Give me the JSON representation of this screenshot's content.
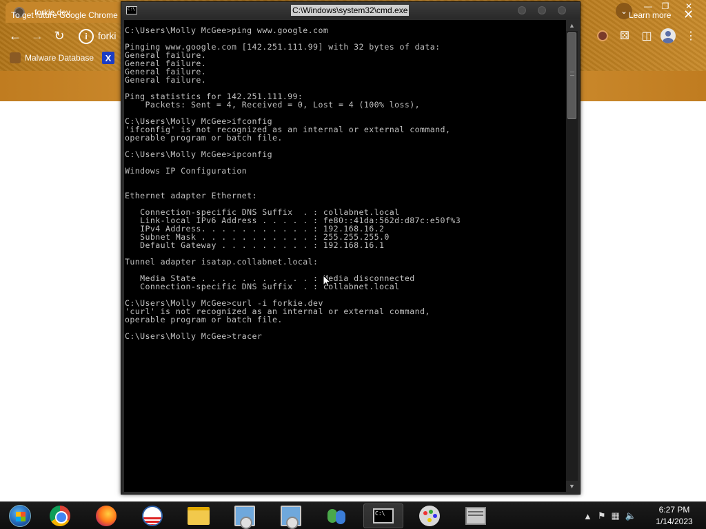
{
  "browser": {
    "tab_title": "forkie.dev",
    "address_text": "forki",
    "bookmarks": [
      {
        "label": "Malware Database"
      },
      {
        "label": ""
      }
    ],
    "infobar": {
      "text": "To get future Google Chrome",
      "learn_more": "Learn more"
    },
    "colors": {
      "theme": "#c08228"
    }
  },
  "cmd": {
    "title": "C:\\Windows\\system32\\cmd.exe",
    "icon_text": "C:\\",
    "console_lines": [
      "C:\\Users\\Molly McGee>ping www.google.com",
      "",
      "Pinging www.google.com [142.251.111.99] with 32 bytes of data:",
      "General failure.",
      "General failure.",
      "General failure.",
      "General failure.",
      "",
      "Ping statistics for 142.251.111.99:",
      "    Packets: Sent = 4, Received = 0, Lost = 4 (100% loss),",
      "",
      "C:\\Users\\Molly McGee>ifconfig",
      "'ifconfig' is not recognized as an internal or external command,",
      "operable program or batch file.",
      "",
      "C:\\Users\\Molly McGee>ipconfig",
      "",
      "Windows IP Configuration",
      "",
      "",
      "Ethernet adapter Ethernet:",
      "",
      "   Connection-specific DNS Suffix  . : collabnet.local",
      "   Link-local IPv6 Address . . . . . : fe80::41da:562d:d87c:e50f%3",
      "   IPv4 Address. . . . . . . . . . . : 192.168.16.2",
      "   Subnet Mask . . . . . . . . . . . : 255.255.255.0",
      "   Default Gateway . . . . . . . . . : 192.168.16.1",
      "",
      "Tunnel adapter isatap.collabnet.local:",
      "",
      "   Media State . . . . . . . . . . . : Media disconnected",
      "   Connection-specific DNS Suffix  . : collabnet.local",
      "",
      "C:\\Users\\Molly McGee>curl -i forkie.dev",
      "'curl' is not recognized as an internal or external command,",
      "operable program or batch file.",
      "",
      "C:\\Users\\Molly McGee>tracer"
    ]
  },
  "taskbar": {
    "items": [
      {
        "icon": "start-orb-icon"
      },
      {
        "icon": "chrome-icon"
      },
      {
        "icon": "firefox-icon"
      },
      {
        "icon": "obama-logo-icon"
      },
      {
        "icon": "folder-icon"
      },
      {
        "icon": "installer-icon"
      },
      {
        "icon": "installer-icon"
      },
      {
        "icon": "users-icon"
      },
      {
        "icon": "cmd-icon",
        "active": true
      },
      {
        "icon": "paint-icon"
      },
      {
        "icon": "archive-icon"
      }
    ],
    "tray_icons": [
      "chevron-up-icon",
      "flag-icon",
      "network-icon",
      "volume-icon"
    ],
    "clock": {
      "time": "6:27 PM",
      "date": "1/14/2023"
    }
  }
}
